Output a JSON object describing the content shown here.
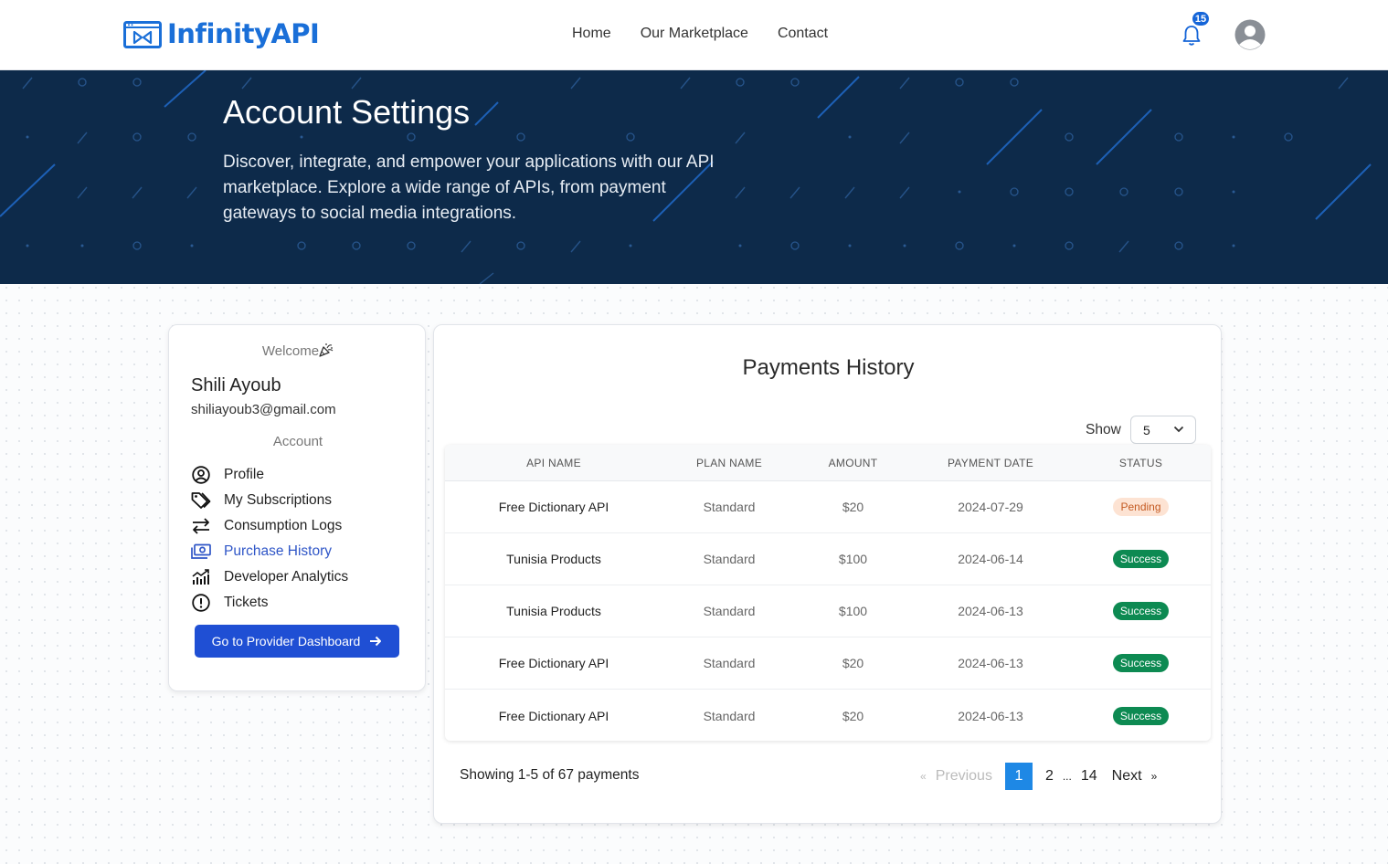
{
  "nav": {
    "brand": "InfinityAPI",
    "links": [
      "Home",
      "Our Marketplace",
      "Contact"
    ],
    "notification_count": "15"
  },
  "hero": {
    "title": "Account Settings",
    "description": "Discover, integrate, and empower your applications with our API marketplace. Explore a wide range of APIs, from payment gateways to social media integrations."
  },
  "sidebar": {
    "welcome": "Welcome",
    "name": "Shili Ayoub",
    "email": "shiliayoub3@gmail.com",
    "section_label": "Account",
    "items": [
      {
        "label": "Profile",
        "icon": "user-circle-icon"
      },
      {
        "label": "My Subscriptions",
        "icon": "tags-icon"
      },
      {
        "label": "Consumption Logs",
        "icon": "arrows-exchange-icon"
      },
      {
        "label": "Purchase History",
        "icon": "money-bill-icon",
        "active": true
      },
      {
        "label": "Developer Analytics",
        "icon": "chart-icon"
      },
      {
        "label": "Tickets",
        "icon": "exclamation-circle-icon"
      }
    ],
    "provider_button": "Go to Provider Dashboard"
  },
  "payments": {
    "title": "Payments History",
    "show_label": "Show",
    "page_size": "5",
    "columns": [
      "API NAME",
      "PLAN NAME",
      "AMOUNT",
      "PAYMENT DATE",
      "STATUS"
    ],
    "rows": [
      {
        "api": "Free Dictionary API",
        "plan": "Standard",
        "amount": "$20",
        "date": "2024-07-29",
        "status": "Pending"
      },
      {
        "api": "Tunisia Products",
        "plan": "Standard",
        "amount": "$100",
        "date": "2024-06-14",
        "status": "Success"
      },
      {
        "api": "Tunisia Products",
        "plan": "Standard",
        "amount": "$100",
        "date": "2024-06-13",
        "status": "Success"
      },
      {
        "api": "Free Dictionary API",
        "plan": "Standard",
        "amount": "$20",
        "date": "2024-06-13",
        "status": "Success"
      },
      {
        "api": "Free Dictionary API",
        "plan": "Standard",
        "amount": "$20",
        "date": "2024-06-13",
        "status": "Success"
      }
    ],
    "summary": "Showing 1-5 of 67 payments",
    "pagination": {
      "prev_symbol": "«",
      "prev": "Previous",
      "pages": [
        "1",
        "2",
        "...",
        "14"
      ],
      "current": "1",
      "next": "Next",
      "next_symbol": "»"
    }
  },
  "colors": {
    "brand": "#1a6fd8",
    "hero_bg": "#0d2a4a",
    "primary_button": "#1f4fd4",
    "success": "#0d8a52",
    "pending_bg": "#fde3d3",
    "active_link": "#2f56c7"
  }
}
